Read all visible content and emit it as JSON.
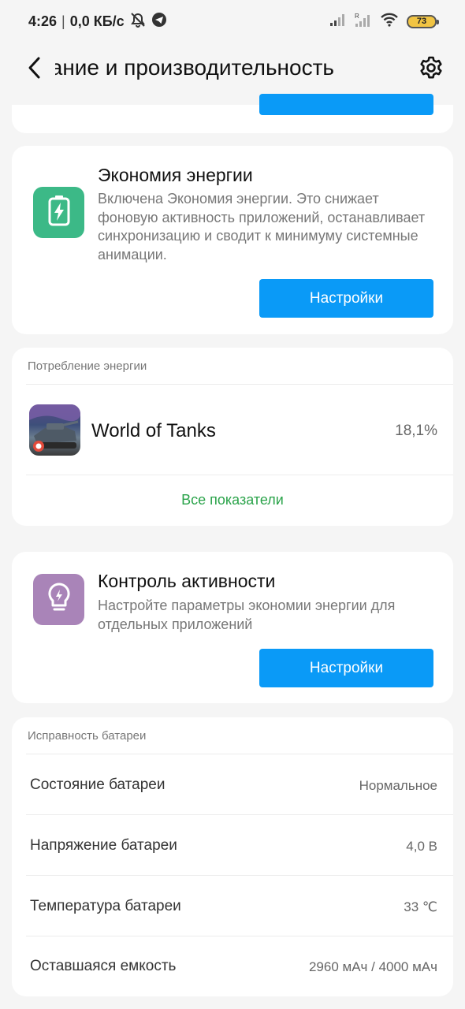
{
  "status_bar": {
    "time": "4:26",
    "separator": "|",
    "network_speed": "0,0 КБ/с",
    "battery_level": "73",
    "icons": [
      "mute-alarm-icon",
      "telegram-icon",
      "signal-icon",
      "signal-roaming-icon",
      "wifi-icon",
      "battery-icon"
    ]
  },
  "header": {
    "title": "Питание и производительность",
    "back_icon": "chevron-left-icon",
    "settings_icon": "gear-icon"
  },
  "energy_saving": {
    "title": "Экономия энергии",
    "description": "Включена Экономия энергии. Это снижает фоновую активность приложений, останавливает синхронизацию и сводит к минимуму системные анимации.",
    "button_label": "Настройки",
    "icon": "battery-bolt-icon",
    "icon_color": "#3cb987"
  },
  "consumption": {
    "section_label": "Потребление энергии",
    "apps": [
      {
        "name": "World of Tanks",
        "percent": "18,1%"
      }
    ],
    "all_link": "Все показатели",
    "link_color": "#2aa34a"
  },
  "activity_control": {
    "title": "Контроль активности",
    "description": "Настройте параметры экономии энергии для отдельных приложений",
    "button_label": "Настройки",
    "icon": "lightbulb-icon",
    "icon_color": "#a984b8"
  },
  "battery_health": {
    "section_label": "Исправность батареи",
    "rows": [
      {
        "label": "Состояние батареи",
        "value": "Нормальное"
      },
      {
        "label": "Напряжение батареи",
        "value": "4,0 В"
      },
      {
        "label": "Температура батареи",
        "value": "33 ℃"
      },
      {
        "label": "Оставшаяся емкость",
        "value": "2960 мАч / 4000 мАч"
      }
    ]
  },
  "colors": {
    "accent_button": "#0a9af7",
    "background": "#f5f5f5",
    "card": "#ffffff"
  }
}
